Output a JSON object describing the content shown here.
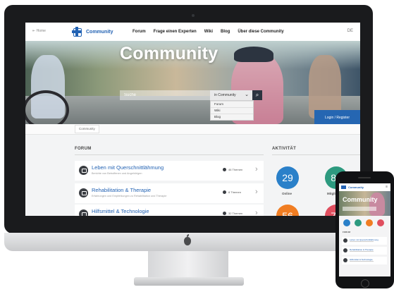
{
  "site": {
    "nav": {
      "back_label": "Home",
      "brand": "Community",
      "links": [
        "Forum",
        "Frage einen Experten",
        "Wiki",
        "Blog",
        "Über diese Community"
      ],
      "user_label": "DE"
    },
    "hero": {
      "title": "Community",
      "search_placeholder": "Suche",
      "scope_selected": "in Community",
      "scope_options": [
        "Forum",
        "Wiki",
        "Blog"
      ],
      "login_label": "Login / Register"
    },
    "breadcrumb": "Community",
    "forum": {
      "heading": "FORUM",
      "rows": [
        {
          "title": "Leben mit Querschnittlähmung",
          "desc": "Berichte von Betroffenen und Angehörigen",
          "count": "46 Themen"
        },
        {
          "title": "Rehabilitation & Therapie",
          "desc": "Erfahrungen und Empfehlungen zu Rehabilitation und Therapie",
          "count": "8 Themen"
        },
        {
          "title": "Hilfsmittel & Technologie",
          "desc": "",
          "count": "32 Themen"
        }
      ]
    },
    "activity": {
      "heading": "AKTIVITÄT",
      "stats": [
        {
          "value": "29",
          "label": "Online",
          "color": "#2a80c9"
        },
        {
          "value": "84",
          "label": "Mitglieder",
          "color": "#2d9a7f"
        },
        {
          "value": "56",
          "label": "",
          "color": "#f07d22"
        },
        {
          "value": "74",
          "label": "",
          "color": "#e04f5f"
        }
      ]
    }
  },
  "phone": {
    "brand": "Community",
    "hero_title": "Community",
    "menu_icon": "≡",
    "section": "FORUM",
    "rows": [
      "Leben mit Querschnittlähmung",
      "Rehabilitation & Therapie",
      "Hilfsmittel & Technologie"
    ]
  },
  "colors": {
    "brand_blue": "#2262b3",
    "device_dark": "#1a1b1d",
    "login_blue": "#2566b2"
  }
}
